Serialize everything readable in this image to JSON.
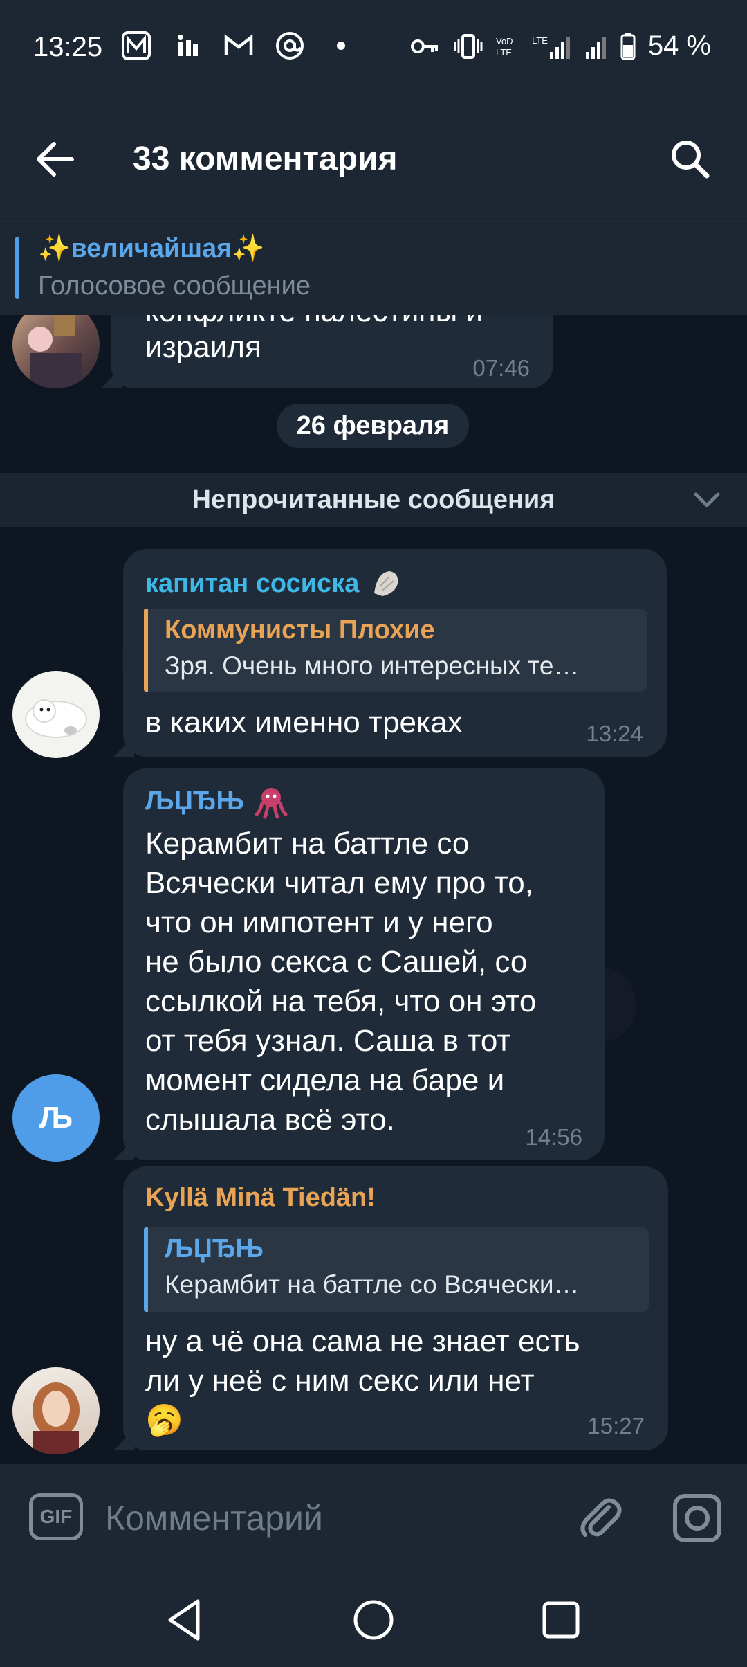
{
  "status_bar": {
    "time": "13:25",
    "battery": "54 %"
  },
  "header": {
    "title": "33 комментария"
  },
  "pinned": {
    "name": "✨величайшая✨",
    "subtitle": "Голосовое сообщение"
  },
  "messages": {
    "first": {
      "line1": "конфликте палестины и",
      "line2": "израиля",
      "time": "07:46"
    },
    "date": "26 февраля",
    "unread": "Непрочитанные сообщения",
    "m1": {
      "sender": "капитан сосиска",
      "reply_name": "Коммунисты Плохие",
      "reply_text": "Зря. Очень много интересных те…",
      "text": "в каких именно треках",
      "time": "13:24"
    },
    "m2": {
      "sender": "ЉЏЂЊ",
      "avatar_letter": "Љ",
      "lines": [
        "Керамбит на баттле со",
        "Всячески читал ему про то,",
        "что он импотент и у него",
        "не было секса с Сашей, со",
        "ссылкой на тебя, что он это",
        "от тебя узнал. Саша в тот",
        "момент сидела на баре и",
        "слышала всё это."
      ],
      "time": "14:56"
    },
    "m3": {
      "sender": "Kyllä Minä Tiedän!",
      "reply_name": "ЉЏЂЊ",
      "reply_text": "Керамбит на баттле со Всячески…",
      "lines": [
        "ну а чё она сама не знает есть",
        "ли у неё с ним секс или нет",
        "🥱"
      ],
      "time": "15:27"
    }
  },
  "composer": {
    "placeholder": "Комментарий",
    "gif_label": "GIF"
  },
  "colors": {
    "header_bg": "#1d2733",
    "bubble_bg": "#1f2b38",
    "accent_blue": "#5ba7ea",
    "sender_cyan": "#3fb8e8",
    "sender_orange": "#e8a454",
    "avatar_blue": "#4f9de8"
  }
}
